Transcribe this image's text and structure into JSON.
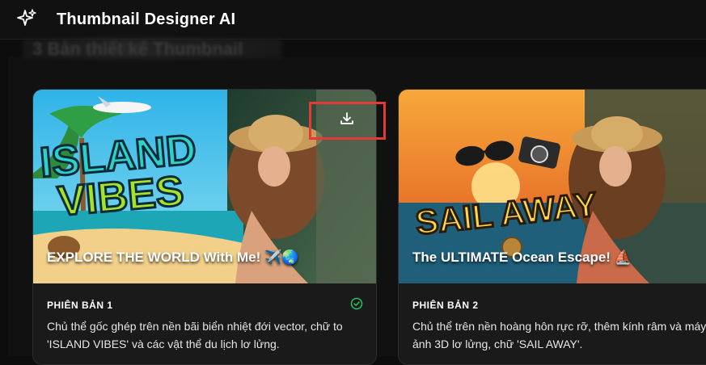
{
  "app": {
    "title": "Thumbnail Designer AI",
    "icon": "sparkles-icon"
  },
  "section": {
    "heading_faded": "3 Bản thiết kế Thumbnail"
  },
  "cards": [
    {
      "thumbnail_title_line1": "ISLAND",
      "thumbnail_title_line2": "VIBES",
      "caption": "EXPLORE THE WORLD With Me! ✈️🌏",
      "version": "PHIÊN BẢN 1",
      "description": "Chủ thể gốc ghép trên nền bãi biển nhiệt đới vector, chữ to 'ISLAND VIBES' và các vật thể du lịch lơ lửng.",
      "selected": true,
      "actions": {
        "download_icon": "download-icon"
      }
    },
    {
      "thumbnail_title": "SAIL AWAY",
      "caption": "The ULTIMATE Ocean Escape! ⛵",
      "version": "PHIÊN BẢN 2",
      "description": "Chủ thể trên nền hoàng hôn rực rỡ, thêm kính râm và máy ảnh 3D lơ lửng, chữ 'SAIL AWAY'.",
      "selected": false
    }
  ],
  "colors": {
    "background": "#0d0d0d",
    "card": "#1a1a1a",
    "highlight": "#e53935",
    "check": "#22c55e"
  }
}
